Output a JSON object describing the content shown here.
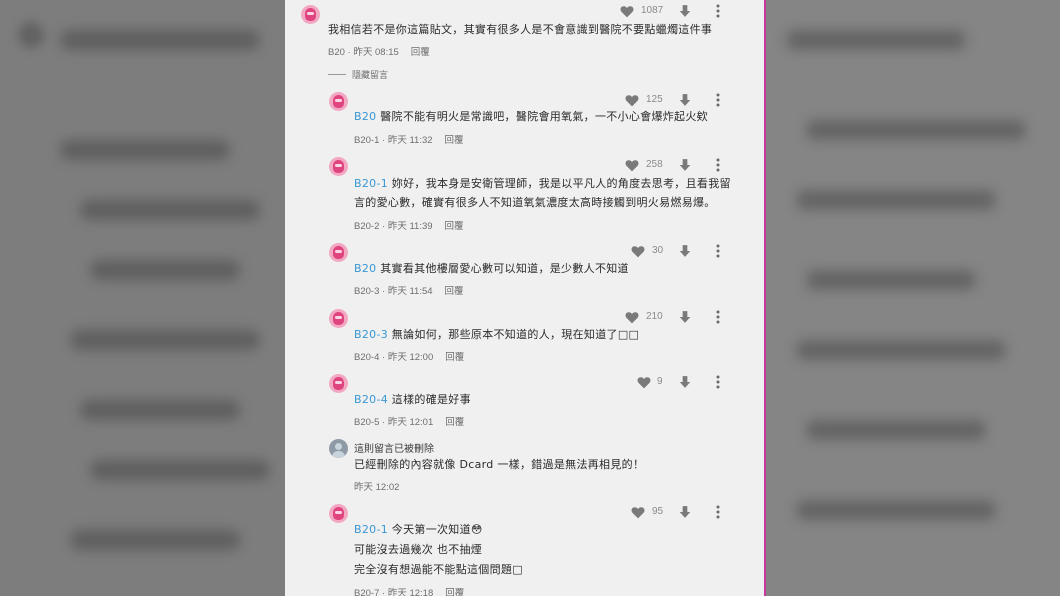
{
  "comments": [
    {
      "likes": "1087",
      "text": "我相信若不是你這篇貼文，其實有很多人是不會意識到醫院不要點蠟燭這件事",
      "floor": "B20",
      "time": "昨天 08:15",
      "reply": "回覆"
    },
    {
      "likes": "125",
      "tag": "B20",
      "text": " 醫院不能有明火是常識吧，醫院會用氧氣，一不小心會爆炸起火欸",
      "floor": "B20-1",
      "time": "昨天 11:32",
      "reply": "回覆"
    },
    {
      "likes": "258",
      "tag": "B20-1",
      "text": " 妳好，我本身是安衛管理師，我是以平凡人的角度去思考，且看我留",
      "text2": "言的愛心數，確實有很多人不知道氧氣濃度太高時接觸到明火易燃易爆。",
      "floor": "B20-2",
      "time": "昨天 11:39",
      "reply": "回覆"
    },
    {
      "likes": "30",
      "tag": "B20",
      "text": " 其實看其他樓層愛心數可以知道，是少數人不知道",
      "floor": "B20-3",
      "time": "昨天 11:54",
      "reply": "回覆"
    },
    {
      "likes": "210",
      "tag": "B20-3",
      "text": " 無論如何，那些原本不知道的人，現在知道了",
      "text_suffix": "□□",
      "floor": "B20-4",
      "time": "昨天 12:00",
      "reply": "回覆"
    },
    {
      "likes": "9",
      "tag": "B20-4",
      "text": " 這樣的確是好事",
      "floor": "B20-5",
      "time": "昨天 12:01",
      "reply": "回覆"
    },
    {
      "likes": "95",
      "tag": "B20-1",
      "text": " 今天第一次知道",
      "emoji": "😳",
      "text2": "可能沒去過幾次 也不抽煙",
      "text3": "完全沒有想過能不能點這個問題□",
      "floor": "B20-7",
      "time": "昨天 12:18",
      "reply": "回覆"
    }
  ],
  "hidden_toggle": "隱藏留言",
  "deleted": {
    "title": "這則留言已被刪除",
    "text": "已經刪除的內容就像 Dcard 一樣，錯過是無法再相見的！",
    "time": "昨天 12:02"
  },
  "colors": {
    "tag": "#3a97d4",
    "panel_bg": "#f0f0f0",
    "avatar_pink": "#e0447f",
    "border": "#c8379a"
  },
  "icons": [
    "heart-icon",
    "thumb-down-icon",
    "more-options-icon",
    "avatar-icon"
  ]
}
